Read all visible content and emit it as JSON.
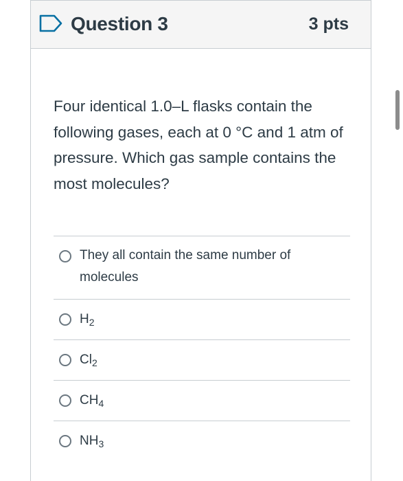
{
  "question": {
    "title": "Question 3",
    "points": "3 pts",
    "text": "Four identical 1.0–L flasks contain the following gases, each at 0 °C and 1 atm of pressure. Which gas sample contains the most molecules?"
  },
  "answers": [
    {
      "text": "They all contain the same number of molecules",
      "base": "",
      "sub": "",
      "selected": false
    },
    {
      "text": "",
      "base": "H",
      "sub": "2",
      "selected": false
    },
    {
      "text": "",
      "base": "Cl",
      "sub": "2",
      "selected": false
    },
    {
      "text": "",
      "base": "CH",
      "sub": "4",
      "selected": false
    },
    {
      "text": "",
      "base": "NH",
      "sub": "3",
      "selected": false
    }
  ],
  "icons": {
    "flag": "bookmark-flag-icon"
  },
  "colors": {
    "accent": "#0770a3",
    "text": "#2d3b45",
    "border": "#c7cdd1",
    "header_bg": "#f5f5f5"
  }
}
